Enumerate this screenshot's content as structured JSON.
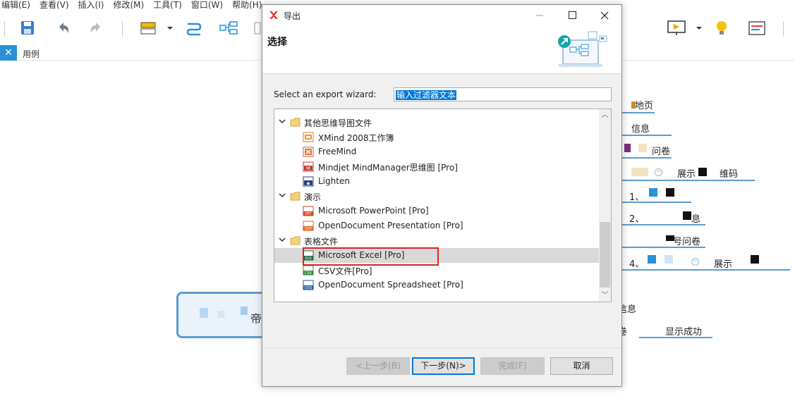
{
  "menu": [
    "编辑(E)",
    "查看(V)",
    "插入(I)",
    "修改(M)",
    "工具(T)",
    "窗口(W)",
    "帮助(H)"
  ],
  "editor_tab": {
    "label": "用例"
  },
  "central_topic": {
    "text": "帝"
  },
  "mind_nodes": [
    "地页",
    "信息",
    "问卷",
    "展示",
    "维码",
    "1、",
    "2、",
    "息",
    "号问卷",
    "4、",
    "展示",
    "信息",
    "显示成功",
    "卷"
  ],
  "dialog": {
    "title": "导出",
    "header_title": "选择",
    "wizard_label": "Select an export wizard:",
    "filter_value": "输入过滤器文本",
    "tree": [
      {
        "label": "其他思维导图文件",
        "type": "folder"
      },
      {
        "label": "XMind 2008工作簿",
        "type": "item",
        "icon": "xmind-icon"
      },
      {
        "label": "FreeMind",
        "type": "item",
        "icon": "freemind-icon"
      },
      {
        "label": "Mindjet MindManager思维图 [Pro]",
        "type": "item",
        "icon": "mindmanager-icon"
      },
      {
        "label": "Lighten",
        "type": "item",
        "icon": "lighten-icon"
      },
      {
        "label": "演示",
        "type": "folder"
      },
      {
        "label": "Microsoft PowerPoint [Pro]",
        "type": "item",
        "icon": "ppt-icon"
      },
      {
        "label": "OpenDocument Presentation [Pro]",
        "type": "item",
        "icon": "odp-icon"
      },
      {
        "label": "表格文件",
        "type": "folder"
      },
      {
        "label": "Microsoft Excel [Pro]",
        "type": "item",
        "icon": "xls-icon",
        "selected": true
      },
      {
        "label": "CSV文件[Pro]",
        "type": "item",
        "icon": "csv-icon"
      },
      {
        "label": "OpenDocument Spreadsheet [Pro]",
        "type": "item",
        "icon": "ods-icon"
      }
    ],
    "icon_texts": {
      "ppt": "PPT",
      "odp": "ODP",
      "xls": "XLS",
      "csv": "CSV",
      "ods": "ODS",
      "mindmanager": "M",
      "lighten": "★"
    },
    "buttons": {
      "back": "<上一步(B)",
      "next": "下一步(N)>",
      "finish": "完成(F)",
      "cancel": "取消"
    }
  },
  "colors": {
    "accent": "#2a91d8",
    "selection": "#0078d7",
    "highlight": "#e02020"
  }
}
